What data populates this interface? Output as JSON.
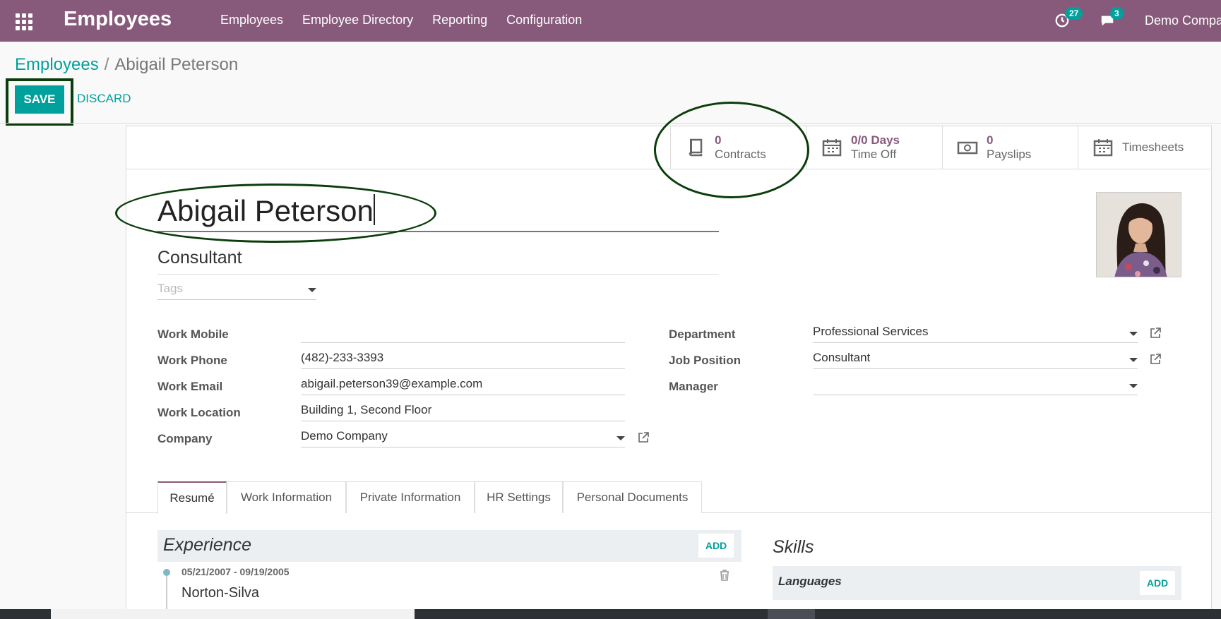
{
  "navbar": {
    "app_title": "Employees",
    "menu": [
      "Employees",
      "Employee Directory",
      "Reporting",
      "Configuration"
    ],
    "activity_count": "27",
    "message_count": "3",
    "company": "Demo Company"
  },
  "breadcrumb": {
    "parent": "Employees",
    "separator": "/",
    "current": "Abigail Peterson"
  },
  "actions": {
    "save": "SAVE",
    "discard": "DISCARD"
  },
  "stat_buttons": {
    "contracts_value": "0",
    "contracts_label": "Contracts",
    "timeoff_value": "0/0 Days",
    "timeoff_label": "Time Off",
    "payslips_value": "0",
    "payslips_label": "Payslips",
    "timesheets_label": "Timesheets"
  },
  "employee": {
    "name": "Abigail Peterson",
    "job_title": "Consultant",
    "tags_placeholder": "Tags"
  },
  "fields_left": {
    "work_mobile_label": "Work Mobile",
    "work_mobile": "",
    "work_phone_label": "Work Phone",
    "work_phone": "(482)-233-3393",
    "work_email_label": "Work Email",
    "work_email": "abigail.peterson39@example.com",
    "work_location_label": "Work Location",
    "work_location": "Building 1, Second Floor",
    "company_label": "Company",
    "company": "Demo Company"
  },
  "fields_right": {
    "department_label": "Department",
    "department": "Professional Services",
    "job_position_label": "Job Position",
    "job_position": "Consultant",
    "manager_label": "Manager",
    "manager": ""
  },
  "tabs": [
    "Resumé",
    "Work Information",
    "Private Information",
    "HR Settings",
    "Personal Documents"
  ],
  "resume": {
    "experience_title": "Experience",
    "add_label": "ADD",
    "entry_date": "05/21/2007 - 09/19/2005",
    "entry_company": "Norton-Silva",
    "skills_title": "Skills",
    "languages_title": "Languages"
  },
  "colors": {
    "brand": "#875a7b",
    "accent": "#00a09d",
    "annotation": "#0b3d0b"
  }
}
